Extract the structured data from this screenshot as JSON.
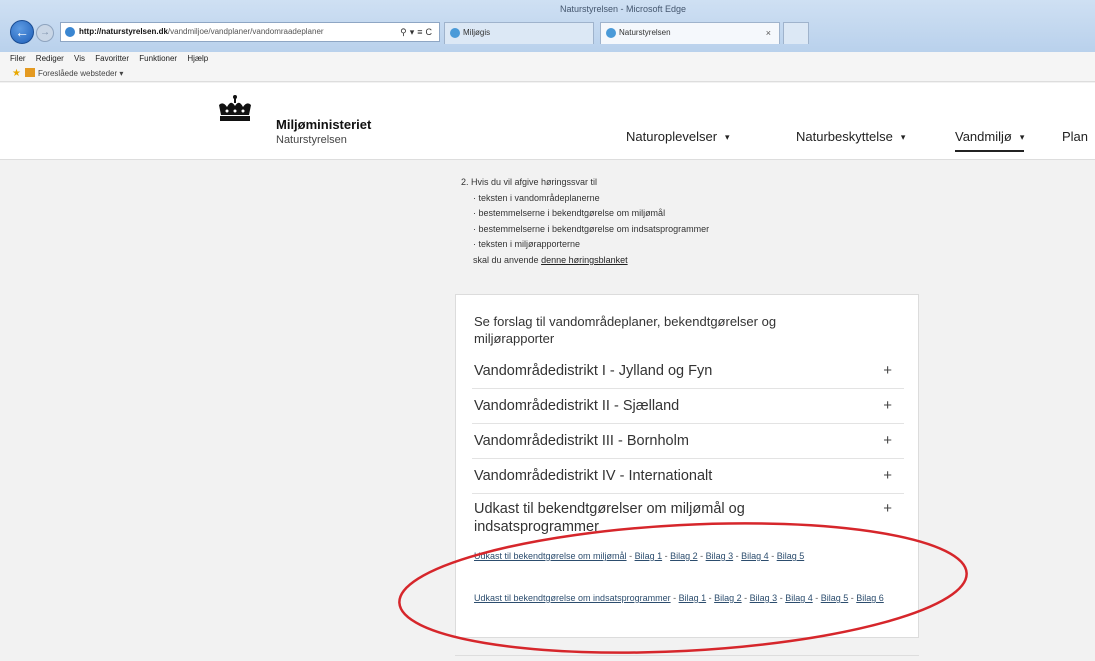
{
  "browser": {
    "window_title": "Naturstyrelsen - Microsoft Edge",
    "address_host": "http://naturstyrelsen.dk",
    "address_path": "/vandmiljoe/vandplaner/vandomraadeplaner",
    "tabs": [
      {
        "label": "Miljøgis"
      },
      {
        "label": "Naturstyrelsen",
        "close": "×"
      }
    ],
    "menu": [
      "Filer",
      "Rediger",
      "Vis",
      "Favoritter",
      "Funktioner",
      "Hjælp"
    ],
    "favorites_label": "Foreslåede websteder ▾"
  },
  "site": {
    "brand_title": "Miljøministeriet",
    "brand_subtitle": "Naturstyrelsen",
    "nav": [
      {
        "label": "Naturoplevelser",
        "caret": "▾"
      },
      {
        "label": "Naturbeskyttelse",
        "caret": "▾"
      },
      {
        "label": "Vandmiljø",
        "caret": "▾"
      },
      {
        "label": "Plan"
      }
    ]
  },
  "intro": {
    "lead": "2.  Hvis du vil afgive høringssvar til",
    "items": [
      "· teksten i vandområdeplanerne",
      "· bestemmelserne i bekendtgørelse om miljømål",
      "· bestemmelserne i bekendtgørelse om indsatsprogrammer",
      "· teksten i miljørapporterne"
    ],
    "closing_prefix": "skal du anvende ",
    "closing_link": "denne høringsblanket"
  },
  "card": {
    "title": "Se forslag til vandområdeplaner, bekendtgørelser og miljørapporter",
    "accordion": [
      {
        "label": "Vandområdedistrikt I - Jylland og Fyn",
        "icon": "+"
      },
      {
        "label": "Vandområdedistrikt II - Sjælland",
        "icon": "+"
      },
      {
        "label": "Vandområdedistrikt III - Bornholm",
        "icon": "+"
      },
      {
        "label": "Vandområdedistrikt IV - Internationalt",
        "icon": "+"
      }
    ],
    "expanded": {
      "label": "Udkast til bekendtgørelser om miljømål og indsatsprogrammer",
      "icon": "+",
      "group1": {
        "main": "Udkast til bekendtgørelse om miljømål",
        "sep": " - ",
        "blag": [
          "Bilag 1",
          "Bilag 2",
          "Bilag 3",
          "Bilag 4",
          "Bilag 5"
        ]
      },
      "group2": {
        "main": "Udkast til bekendtgørelse om indsatsprogrammer",
        "sep": " - ",
        "blag": [
          "Bilag 1",
          "Bilag 2",
          "Bilag 3",
          "Bilag 4",
          "Bilag 5",
          "Bilag 6"
        ]
      }
    }
  },
  "colors": {
    "annotation": "#d6262b"
  }
}
